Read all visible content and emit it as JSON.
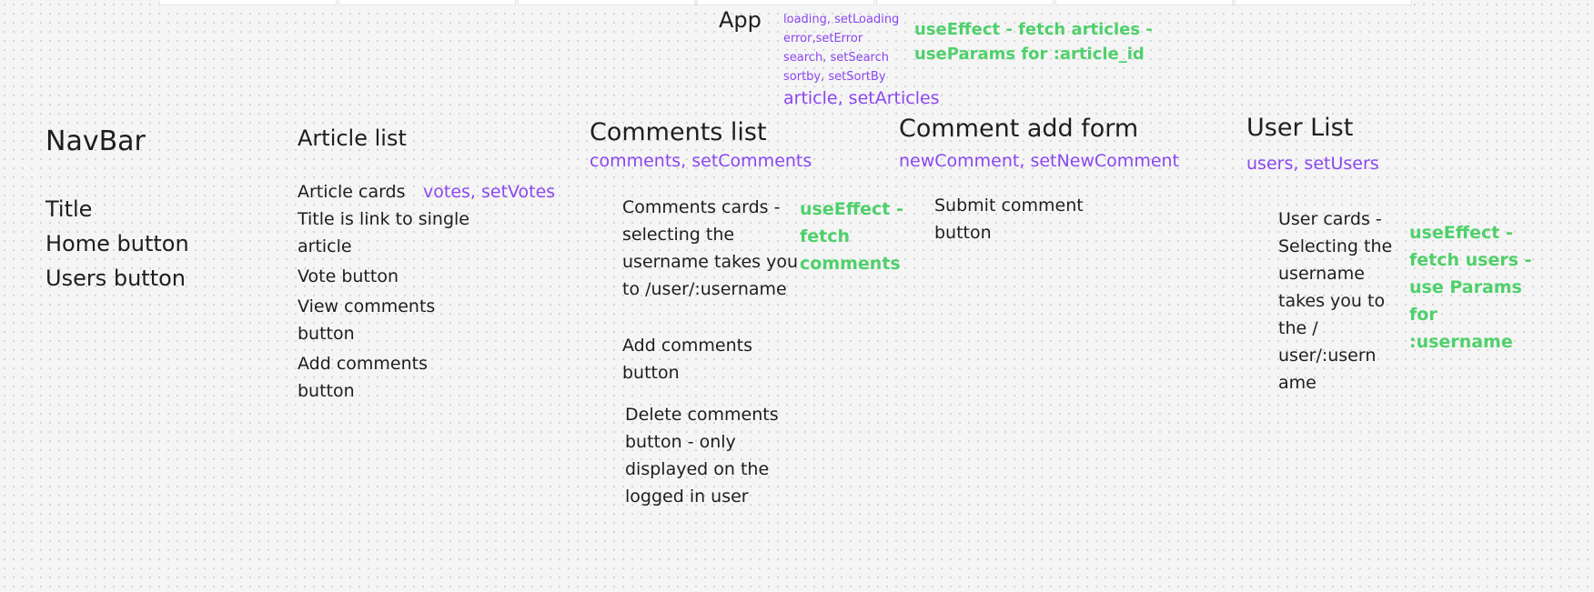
{
  "app": {
    "title": "App",
    "state_lines": [
      "loading, setLoading",
      "error,setError",
      "search, setSearch",
      "sortby, setSortBy"
    ],
    "article_state": "article, setArticles",
    "effect": "useEffect - fetch articles -\nuseParams for :article_id"
  },
  "navbar": {
    "title": "NavBar",
    "items": [
      "Title",
      "Home button",
      "Users button"
    ]
  },
  "article_list": {
    "title": "Article list",
    "cards_label": "Article cards",
    "state": "votes, setVotes",
    "items": [
      "Title is link to single\narticle",
      "Vote button",
      "View comments\nbutton",
      "Add comments\nbutton"
    ]
  },
  "comments_list": {
    "title": "Comments list",
    "state": "comments, setComments",
    "cards": "Comments cards -\nselecting the\nusername takes you\nto /user/:username",
    "effect": "useEffect -\nfetch\ncomments",
    "add_button": "Add comments\nbutton",
    "delete_button": "Delete comments\nbutton - only\ndisplayed on the\nlogged in user"
  },
  "comment_form": {
    "title": "Comment add form",
    "state": "newComment, setNewComment",
    "submit": "Submit comment\nbutton"
  },
  "user_list": {
    "title": "User List",
    "state": "users, setUsers",
    "cards": "User cards -\nSelecting the\nusername\ntakes you to\nthe /\nuser/:usern\name",
    "effect": "useEffect -\nfetch users -\nuse Params\nfor\n:username"
  },
  "colors": {
    "state": "#8b47f0",
    "effect": "#4fd06b",
    "text": "#1e1e1e",
    "canvas": "#f5f5f5"
  }
}
